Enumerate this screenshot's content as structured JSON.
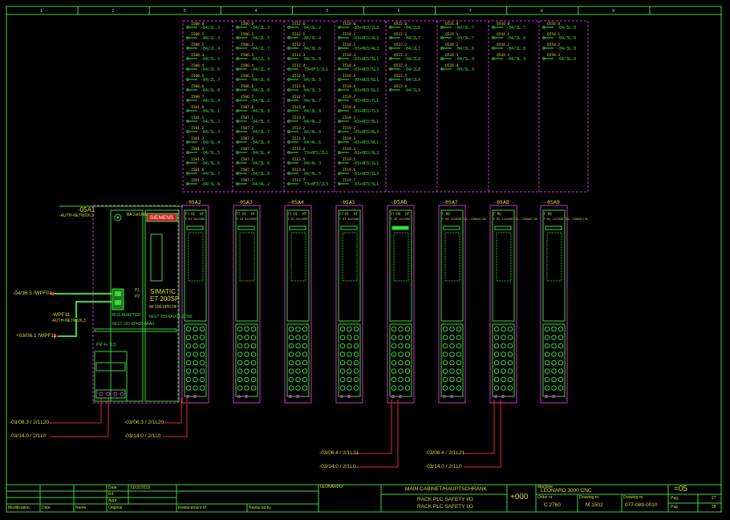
{
  "column_numbers": [
    "1",
    "2",
    "3",
    "4",
    "5",
    "6",
    "7",
    "8",
    "9"
  ],
  "modules": [
    {
      "tag": "-05A2",
      "type": "F-DI 8x24VDC",
      "highlight": false,
      "top": "Fl-DI",
      "hf": "HF"
    },
    {
      "tag": "-05A3",
      "type": "F-DI 8x24VDC",
      "highlight": false,
      "top": "Fl-DI",
      "hf": "HF"
    },
    {
      "tag": "-05A4",
      "type": "F-DI 8x24VDC",
      "highlight": false,
      "top": "Fl-DI",
      "hf": "HF"
    },
    {
      "tag": "-05A5",
      "type": "F-DI 8x24VDC",
      "highlight": false,
      "top": "Fl-DI",
      "hf": "HF"
    },
    {
      "tag": "-05A6",
      "type": "F-DQ 4x24VDC",
      "highlight": true,
      "top": "Fl-DQ",
      "hf": "HF"
    },
    {
      "tag": "-05A7",
      "type": "F-RQ 1x24VDC/24..230VAC/5A",
      "highlight": false,
      "top": "F-RQ",
      "hf": ""
    },
    {
      "tag": "-05A8",
      "type": "F-RQ 1x24VDC/24..230VAC/5A",
      "highlight": false,
      "top": "F-RQ",
      "hf": ""
    },
    {
      "tag": "-05A9",
      "type": "F-RQ 1x24VDC/24..230VAC/5A",
      "highlight": false,
      "top": "F-RQ",
      "hf": ""
    }
  ],
  "io_columns": [
    {
      "rows": [
        [
          "I500.0",
          "-04/2L.2"
        ],
        [
          "I500.1",
          "-04/2L.3"
        ],
        [
          "I500.2",
          "-04/2L.4"
        ],
        [
          "I500.3",
          "-04/2L.5"
        ],
        [
          "I500.4",
          "-04/2L.6"
        ],
        [
          "I500.5",
          "-04/2L.7"
        ],
        [
          "I500.6",
          "-04/2L.8"
        ],
        [
          "I500.7",
          "-04/2L.9"
        ],
        [
          "I501.0",
          "-04/3L.1"
        ],
        [
          "I501.1",
          "-04/3L.2"
        ],
        [
          "I501.2",
          "-04/3L.3"
        ],
        [
          "I501.3",
          "-04/3L.4"
        ],
        [
          "I501.4",
          "-04/3L.5"
        ],
        [
          "I501.5",
          "-04/3L.6"
        ],
        [
          "I501.6",
          "-04/3L.7"
        ],
        [
          "I501.7",
          "-04/3L.8"
        ]
      ]
    },
    {
      "rows": [
        [
          "I506.0",
          "-04/2L.3"
        ],
        [
          "I506.1",
          "-04/2L.5"
        ],
        [
          "I506.2",
          "-04/2L.7"
        ],
        [
          "I506.3",
          "-04/2L.9"
        ],
        [
          "I506.4",
          "-04/2L.4"
        ],
        [
          "I506.5",
          "-04/2L.6"
        ],
        [
          "I506.6",
          "-04/2L.8"
        ],
        [
          "I506.7",
          "-04/3L.2"
        ],
        [
          "I507.0",
          "-04/3L.3"
        ],
        [
          "I507.1",
          "-04/3L.5"
        ],
        [
          "I507.2",
          "-04/3L.7"
        ],
        [
          "I507.3",
          "-04/3L.9"
        ],
        [
          "I507.4",
          "-04/3L.4"
        ],
        [
          "I507.5",
          "-04/3L.6"
        ],
        [
          "I507.6",
          "-04/3L.8"
        ],
        [
          "I507.7",
          "-04/4L.2"
        ]
      ]
    },
    {
      "rows": [
        [
          "I512.0",
          "-04/3L.2"
        ],
        [
          "I512.1",
          "-04/3L.4"
        ],
        [
          "I512.2",
          "-04/3L.6"
        ],
        [
          "I512.3",
          "-04/3L.8"
        ],
        [
          "I512.4",
          "-73+0F3/2L1"
        ],
        [
          "I512.5",
          "-04/3L.3"
        ],
        [
          "I512.6",
          "-04/3L.5"
        ],
        [
          "I512.7",
          "-04/3L.7"
        ],
        [
          "I513.0",
          "-04/3L.9"
        ],
        [
          "I513.1",
          "-04/4L.2"
        ],
        [
          "I513.2",
          "-04/4L.4"
        ],
        [
          "I513.3",
          "-04/4L.6"
        ],
        [
          "I513.4",
          "-73+0F3/2L1"
        ],
        [
          "I513.5",
          "-04/4L.3"
        ],
        [
          "I513.6",
          "-04/4L.5"
        ],
        [
          "I513.7",
          "-73+0F3/2L3"
        ]
      ]
    },
    {
      "rows": [
        [
          "I518.0",
          "-03+0D3/2L3"
        ],
        [
          "I518.1",
          "-03+0D3/4L3"
        ],
        [
          "I518.2",
          "-03+0D3/4L3"
        ],
        [
          "I518.3",
          "-03+0D3/5L1"
        ],
        [
          "I518.4",
          "-03+0D3/5L3"
        ],
        [
          "I518.5",
          "-03+0D3/6L1"
        ],
        [
          "I518.6",
          "-03+0D3/6L3"
        ],
        [
          "I518.7",
          "-03+0D3/7L1"
        ],
        [
          "I519.0",
          "-03+0D3/7L3"
        ],
        [
          "I519.1",
          "-03+0D3/8L1"
        ],
        [
          "I519.2",
          "-03+0D3/8L3"
        ],
        [
          "I519.3",
          "-03+0D3/9L1"
        ],
        [
          "I519.4",
          "-03+0D3/9L3"
        ],
        [
          "I519.5",
          "-03+0D3/2L1"
        ],
        [
          "I519.6",
          "-03+0D3/2L3"
        ],
        [
          "I519.7",
          "-03+0D3/3L1"
        ]
      ]
    },
    {
      "rows": [
        [
          "Q522.0",
          "-04/2L6"
        ],
        [
          "Q522.1",
          "-04/2L7"
        ],
        [
          "Q522.2",
          "-04/2L7"
        ],
        [
          "Q522.3",
          "-04/2L8"
        ],
        [
          "Q522.4",
          "-04/2L8"
        ],
        [
          "Q522.5",
          "-04/2L9"
        ],
        [
          "Q522.6",
          "-04/2L9"
        ]
      ]
    },
    {
      "rows": [
        [
          "Q526.0",
          "-04/3L.7"
        ],
        [
          "Q526.1",
          "-04/3L.7"
        ],
        [
          "Q526.2",
          "-04/3L.8"
        ],
        [
          "Q526.3",
          "-04/3L.9"
        ],
        [
          "Q526.4",
          "-04/3L.9"
        ]
      ]
    },
    {
      "rows": [
        [
          "Q544.0",
          "-04/3L.7"
        ],
        [
          "Q544.1",
          "-04/3L.8"
        ],
        [
          "Q544.2",
          "-04/3L.8"
        ],
        [
          "Q544.3",
          "-04/3L.9"
        ]
      ]
    },
    {
      "rows": [
        [
          "Q550.0",
          "-04/3L.8"
        ],
        [
          "Q550.1",
          "-04/3L.8"
        ],
        [
          "Q550.2",
          "-04/3L.9"
        ],
        [
          "Q550.3",
          "-04/3L.9"
        ]
      ]
    }
  ],
  "interface_module": {
    "tag": "-05A1",
    "subtag": "-AUTH-NETW/26.3",
    "brand": "SIEMENS",
    "family": "SIMATIC",
    "product": "ET 200SP",
    "model": "IM 155-6PN HF",
    "order": "6ES7 155-6AU01-0CN0",
    "server": "6ES7 193-6PA00-0AA0",
    "bus": "BA 2xRJ45",
    "bus_adapter": "BUS ADAPTER",
    "port_p1": "P1",
    "port_p2": "P2",
    "power_terminal": "PM 4+ 1(2)"
  },
  "network": [
    {
      "ref": "-04/36.5 /",
      "label": "WPF01"
    },
    {
      "ref": "-WPF11",
      "label": "-AUTH-NETW/26.3"
    },
    {
      "ref": "+03/06.1 /",
      "label": "WPF11"
    }
  ],
  "power_refs": [
    {
      "ref": "-03/06.3 /",
      "label": "2/1L20"
    },
    {
      "ref": "-03/14.0 /",
      "label": "2/1L0"
    },
    {
      "ref": "-03/06.3 /",
      "label": "2/1L20"
    },
    {
      "ref": "-03/14.0 /",
      "label": "2/1L0"
    },
    {
      "ref": "-03/06.4 /",
      "label": "2/1L21"
    },
    {
      "ref": "-03/14.0 /",
      "label": "2/1L0"
    },
    {
      "ref": "-03/06.4 /",
      "label": "2/1L21"
    },
    {
      "ref": "-03/14.0 /",
      "label": "2/1L0"
    }
  ],
  "title_block": {
    "date_label": "Date",
    "date": "21/02/2019",
    "ed_label": "Ed.",
    "appr_label": "Appr",
    "orig_label": "Original",
    "mod_label": "Modification",
    "date_col": "Date",
    "name_col": "Name",
    "replacement": "Replacement of",
    "replaced": "Replaced by",
    "company": "LEONARDO",
    "title": "MAIN CABINET/HAUPTSCHRANK",
    "sub1": "RACK PLC SAFETY I/O",
    "sub2": "RACK PLC SAFETY I/O",
    "plant": "+000",
    "machine_label": "Machine",
    "machine": "LEONARD 3000 CNC",
    "order_label": "Order nr.",
    "order": "C.2760",
    "drawing_label": "Drawing nr.",
    "drawing": "M.1502",
    "draw2_label": "Drawing nr.",
    "draw2": "077-089-0010",
    "sheet": "=05",
    "pag_label": "Pag.",
    "pag": "27",
    "pag_total": "28",
    "pag_total_label": "Pag"
  }
}
